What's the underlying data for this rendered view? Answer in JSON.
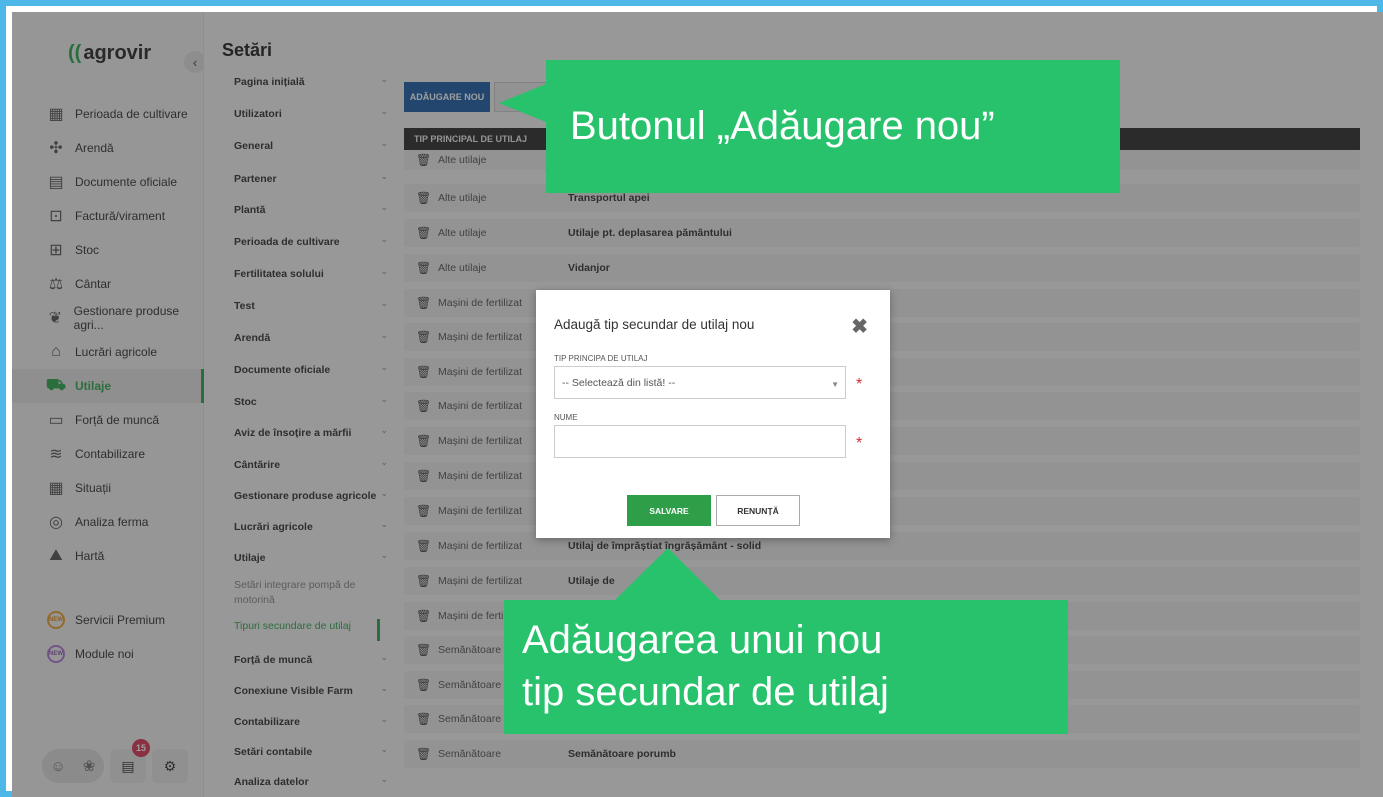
{
  "app": {
    "logo": "agrovir",
    "collapse_icon": "chevron-left-icon",
    "notification_count": "15"
  },
  "sidebar": {
    "items": [
      {
        "label": "Perioada de cultivare",
        "icon": "calendar-icon"
      },
      {
        "label": "Arendă",
        "icon": "puzzle-icon"
      },
      {
        "label": "Documente oficiale",
        "icon": "document-icon"
      },
      {
        "label": "Factură/virament",
        "icon": "invoice-icon"
      },
      {
        "label": "Stoc",
        "icon": "stock-icon"
      },
      {
        "label": "Cântar",
        "icon": "scale-icon"
      },
      {
        "label": "Gestionare produse agri...",
        "icon": "plant-hand-icon"
      },
      {
        "label": "Lucrări agricole",
        "icon": "farm-work-icon"
      },
      {
        "label": "Utilaje",
        "icon": "tractor-icon"
      },
      {
        "label": "Forță de muncă",
        "icon": "id-card-icon"
      },
      {
        "label": "Contabilizare",
        "icon": "accounting-icon"
      },
      {
        "label": "Situații",
        "icon": "table-icon"
      },
      {
        "label": "Analiza ferma",
        "icon": "chart-icon"
      },
      {
        "label": "Hartă",
        "icon": "map-icon"
      },
      {
        "label": "Servicii Premium",
        "icon": "new-badge-icon",
        "badge": "NEW"
      },
      {
        "label": "Module noi",
        "icon": "new-badge-icon",
        "badge": "NEW"
      }
    ]
  },
  "settings": {
    "title": "Setări",
    "items": [
      "Pagina inițială",
      "Utilizatori",
      "General",
      "Partener",
      "Plantă",
      "Perioada de cultivare",
      "Fertilitatea solului",
      "Test",
      "Arendă",
      "Documente oficiale",
      "Stoc",
      "Aviz de însoțire a mărfii",
      "Cântărire",
      "Gestionare produse agricole",
      "Lucrări agricole",
      "Utilaje"
    ],
    "sub_items": [
      "Setări integrare pompă de motorină",
      "Tipuri secundare de utilaj"
    ],
    "items_after": [
      "Forță de muncă",
      "Conexiune Visible Farm",
      "Contabilizare",
      "Setări contabile",
      "Analiza datelor"
    ]
  },
  "main": {
    "add_button": "ADĂUGARE NOU",
    "table_header": "TIP PRINCIPAL DE UTILAJ",
    "rows": [
      {
        "type": "Alte utilaje",
        "name": ""
      },
      {
        "type": "Alte utilaje",
        "name": "Transportul apei"
      },
      {
        "type": "Alte utilaje",
        "name": "Utilaje pt. deplasarea pământului"
      },
      {
        "type": "Alte utilaje",
        "name": "Vidanjor"
      },
      {
        "type": "Mașini de fertilizat",
        "name": ""
      },
      {
        "type": "Mașini de fertilizat",
        "name": ""
      },
      {
        "type": "Mașini de fertilizat",
        "name": ""
      },
      {
        "type": "Mașini de fertilizat",
        "name": ""
      },
      {
        "type": "Mașini de fertilizat",
        "name": ""
      },
      {
        "type": "Mașini de fertilizat",
        "name": ""
      },
      {
        "type": "Mașini de fertilizat",
        "name": ""
      },
      {
        "type": "Mașini de fertilizat",
        "name": "Utilaj de împrăștiat îngrășământ - solid"
      },
      {
        "type": "Mașini de fertilizat",
        "name": "Utilaje de"
      },
      {
        "type": "Mașini de ferti",
        "name": ""
      },
      {
        "type": "Semănătoare",
        "name": ""
      },
      {
        "type": "Semănătoare",
        "name": ""
      },
      {
        "type": "Semănătoare",
        "name": ""
      },
      {
        "type": "Semănătoare",
        "name": "Semănătoare porumb"
      }
    ]
  },
  "modal": {
    "title": "Adaugă tip secundar de utilaj nou",
    "close_icon": "close-icon",
    "field1_label": "TIP PRINCIPA DE UTILAJ",
    "field1_value": "-- Selectează din listă! --",
    "field2_label": "NUME",
    "field2_value": "",
    "required_mark": "*",
    "save_button": "SALVARE",
    "cancel_button": "RENUNȚĂ"
  },
  "callouts": {
    "top": "Butonul „Adăugare nou”",
    "bottom_line1": "Adăugarea unui nou",
    "bottom_line2": "tip secundar de utilaj"
  },
  "colors": {
    "accent_green": "#2fa84f",
    "callout_green": "#27c26b",
    "primary_blue": "#1e5fa8",
    "frame_blue": "#4db7e8"
  }
}
